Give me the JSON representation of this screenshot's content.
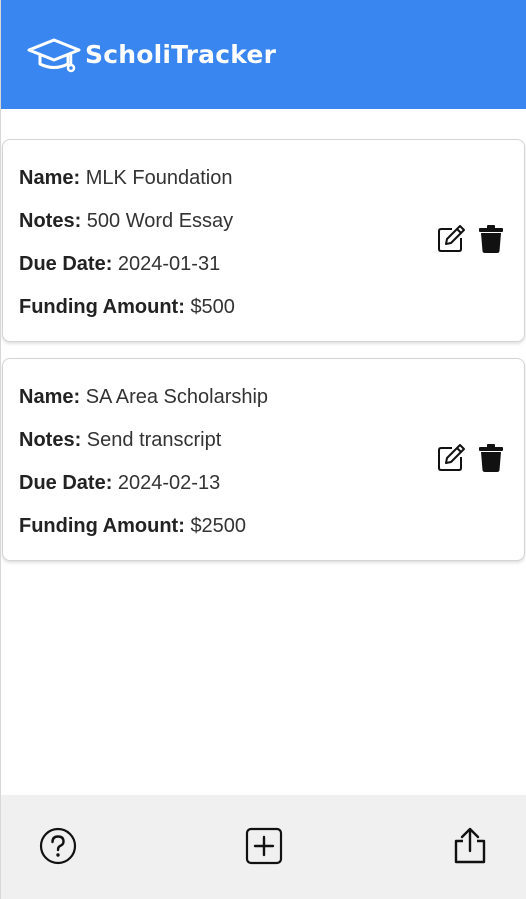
{
  "header": {
    "title": "ScholiTracker",
    "logo_icon": "graduation-cap-icon",
    "background_color": "#3a86f0"
  },
  "labels": {
    "name": "Name:",
    "notes": "Notes:",
    "due_date": "Due Date:",
    "funding_amount": "Funding Amount:"
  },
  "scholarships": [
    {
      "name": "MLK Foundation",
      "notes": "500 Word Essay",
      "due_date": "2024-01-31",
      "funding_amount": "$500"
    },
    {
      "name": "SA Area Scholarship",
      "notes": "Send transcript",
      "due_date": "2024-02-13",
      "funding_amount": "$2500"
    }
  ],
  "card_actions": {
    "edit_icon": "edit-icon",
    "delete_icon": "trash-icon"
  },
  "footer": {
    "help_icon": "help-icon",
    "add_icon": "add-icon",
    "share_icon": "share-icon"
  }
}
